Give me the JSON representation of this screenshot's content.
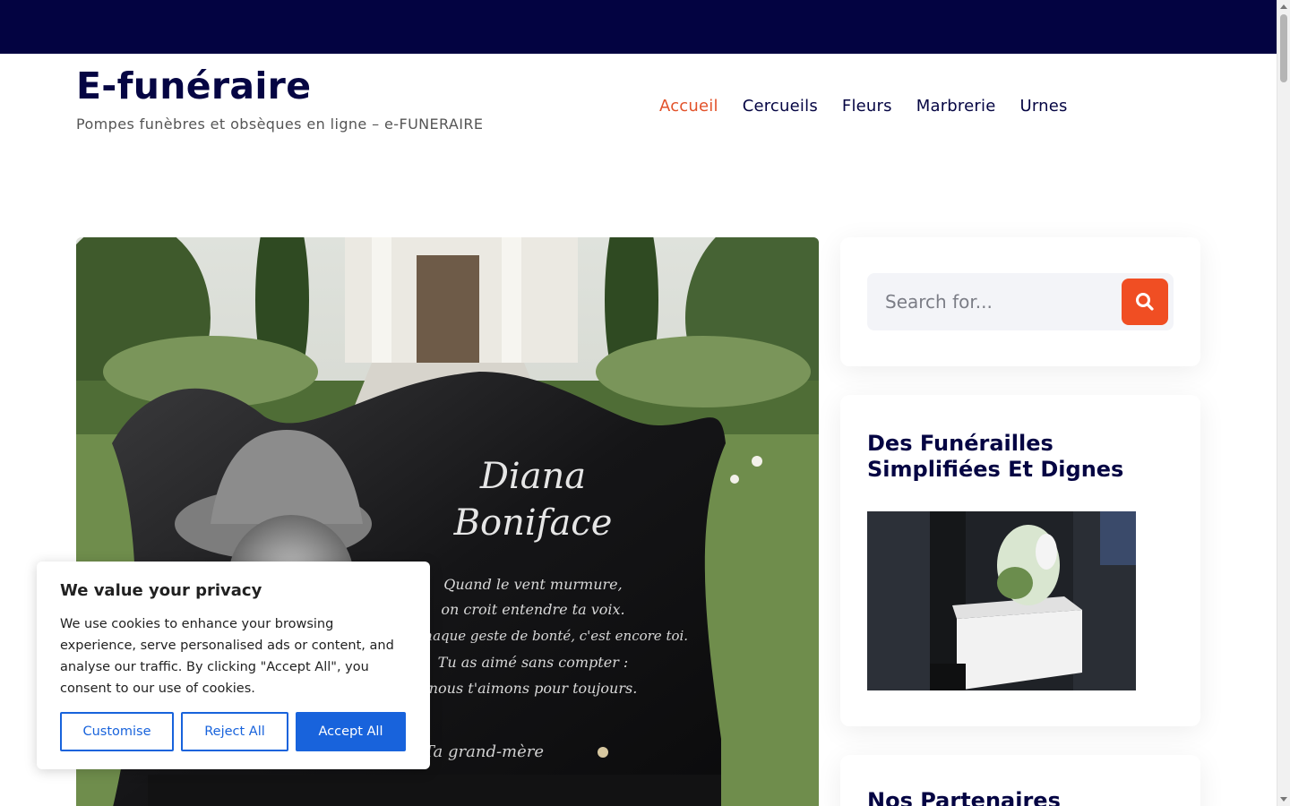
{
  "site": {
    "title": "E-funéraire",
    "tagline": "Pompes funèbres et obsèques en ligne – e-FUNERAIRE"
  },
  "nav": {
    "items": [
      {
        "label": "Accueil",
        "active": true
      },
      {
        "label": "Cercueils",
        "active": false
      },
      {
        "label": "Fleurs",
        "active": false
      },
      {
        "label": "Marbrerie",
        "active": false
      },
      {
        "label": "Urnes",
        "active": false
      }
    ]
  },
  "hero": {
    "plaque": {
      "name_line1": "Diana",
      "name_line2": "Boniface",
      "poem": [
        "Quand le vent murmure,",
        "on croit entendre ta voix.",
        "Dans chaque geste de bonté, c'est encore toi.",
        "Tu as aimé sans compter :",
        "nous t'aimons pour toujours."
      ],
      "signature": "Ta grand-mère"
    }
  },
  "search": {
    "placeholder": "Search for...",
    "icon": "search-icon"
  },
  "widget": {
    "title": "Des Funérailles Simplifiées Et Dignes"
  },
  "partners": {
    "title": "Nos Partenaires"
  },
  "cookie": {
    "title": "We value your privacy",
    "text": "We use cookies to enhance your browsing experience, serve personalised ads or content, and analyse our traffic. By clicking \"Accept All\", you consent to our use of cookies.",
    "customise_label": "Customise",
    "reject_label": "Reject All",
    "accept_label": "Accept All"
  },
  "colors": {
    "topbar": "#030341",
    "brand_text": "#050543",
    "nav_active": "#e2522a",
    "search_button": "#f04e23",
    "cookie_primary": "#1863dc"
  }
}
